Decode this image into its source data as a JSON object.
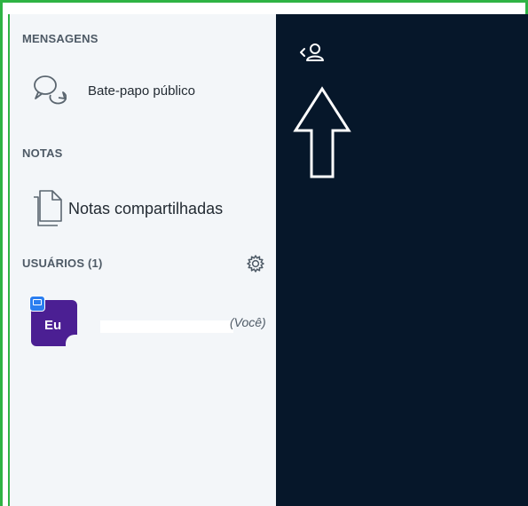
{
  "sidebar": {
    "messages_section": {
      "title": "MENSAGENS",
      "items": [
        {
          "label": "Bate-papo público",
          "icon": "chat-bubbles-icon"
        }
      ]
    },
    "notes_section": {
      "title": "NOTAS",
      "items": [
        {
          "label": "Notas compartilhadas",
          "icon": "document-icon"
        }
      ]
    },
    "users_section": {
      "title": "USUÁRIOS (1)",
      "settings_icon": "gear-icon",
      "users": [
        {
          "avatar_initials": "Eu",
          "you_label": "(Você)",
          "avatar_color": "#4b1f93",
          "presenter_badge_color": "#2a7ef0"
        }
      ]
    }
  },
  "main": {
    "toggle_icon": "chevron-left-user-icon",
    "background": "#06172a"
  },
  "colors": {
    "frame": "#2fb344",
    "sidebar_bg": "#f3f6f9"
  }
}
